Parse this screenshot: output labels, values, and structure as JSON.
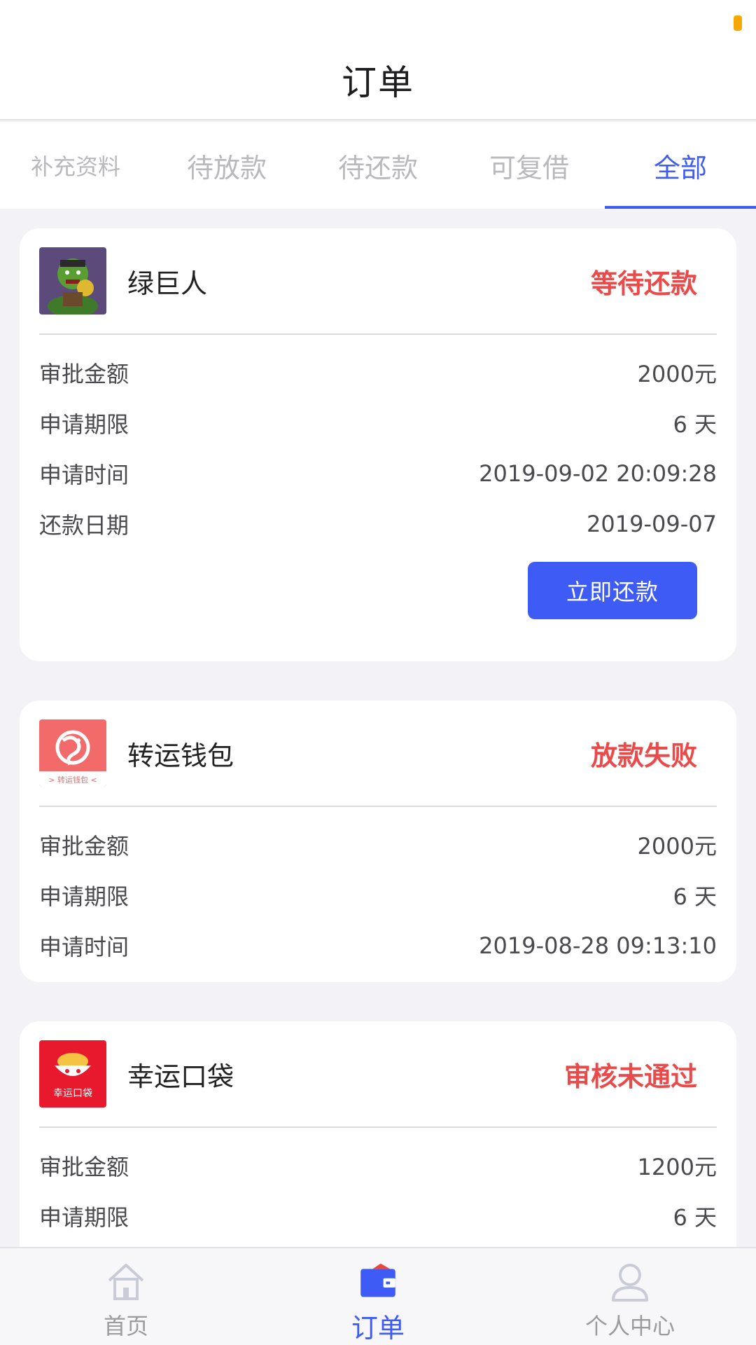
{
  "header": {
    "title": "订单"
  },
  "tabs": [
    {
      "label": "补充资料"
    },
    {
      "label": "待放款"
    },
    {
      "label": "待还款"
    },
    {
      "label": "可复借"
    },
    {
      "label": "全部"
    }
  ],
  "active_tab": "全部",
  "orders": [
    {
      "name": "绿巨人",
      "status": "等待还款",
      "logo_icon": "hulk-avatar",
      "rows": [
        {
          "label": "审批金额",
          "value": "2000元"
        },
        {
          "label": "申请期限",
          "value": "6 天"
        },
        {
          "label": "申请时间",
          "value": "2019-09-02 20:09:28"
        },
        {
          "label": "还款日期",
          "value": "2019-09-07"
        }
      ],
      "action_label": "立即还款"
    },
    {
      "name": "转运钱包",
      "status": "放款失败",
      "logo_icon": "zhuanyun-wallet-logo",
      "logo_text": "> 转运钱包 <",
      "rows": [
        {
          "label": "审批金额",
          "value": "2000元"
        },
        {
          "label": "申请期限",
          "value": "6 天"
        },
        {
          "label": "申请时间",
          "value": "2019-08-28 09:13:10"
        }
      ]
    },
    {
      "name": "幸运口袋",
      "status": "审核未通过",
      "logo_icon": "xingyun-pocket-logo",
      "logo_text": "幸运口袋",
      "rows": [
        {
          "label": "审批金额",
          "value": "1200元"
        },
        {
          "label": "申请期限",
          "value": "6 天"
        }
      ]
    }
  ],
  "bottom_nav": [
    {
      "label": "首页",
      "icon": "home-icon"
    },
    {
      "label": "订单",
      "icon": "wallet-icon"
    },
    {
      "label": "个人中心",
      "icon": "user-icon"
    }
  ],
  "colors": {
    "accent": "#3f5bf6",
    "status_red": "#ea4a4a",
    "status_dot": "#f7a800"
  }
}
